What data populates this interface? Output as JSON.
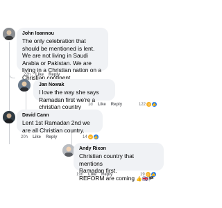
{
  "comments": [
    {
      "author": "John Ioannou",
      "text": "The only celebration that should be mentioned is lent. We are not living in Saudi Arabia or Pakistan. We are living in a Christian nation on a Christian continent.",
      "time": "22h",
      "like_label": "Like",
      "reply_label": "Reply"
    },
    {
      "author": "Jan Nowak",
      "text": "I love the way she says Ramadan first we're a christian country",
      "time": "1d",
      "like_label": "Like",
      "reply_label": "Reply",
      "reaction_count": "122",
      "reactions": [
        "haha-icon",
        "like-icon"
      ]
    },
    {
      "author": "David Cann",
      "text": "Lent 1st Ramadan 2nd we are all Christian country.",
      "time": "20h",
      "like_label": "Like",
      "reply_label": "Reply",
      "reaction_count": "14",
      "reactions": [
        "haha-icon",
        "like-icon"
      ]
    },
    {
      "author": "Andy Rixon",
      "text_line1": "Christian country that mentions",
      "text_line2": "Ramadan first.",
      "text_line3": "REFORM are coming",
      "text_emojis": "👍🇬🇧🏴",
      "time": "19h",
      "like_label": "Like",
      "reply_label": "Reply",
      "reaction_count": "19",
      "reactions": [
        "haha-icon",
        "like-icon"
      ]
    }
  ],
  "colors": {
    "bubble": "#f0f2f5",
    "meta": "#65676b",
    "like_blue": "#1877f2",
    "haha_yellow": "#f7b125"
  }
}
